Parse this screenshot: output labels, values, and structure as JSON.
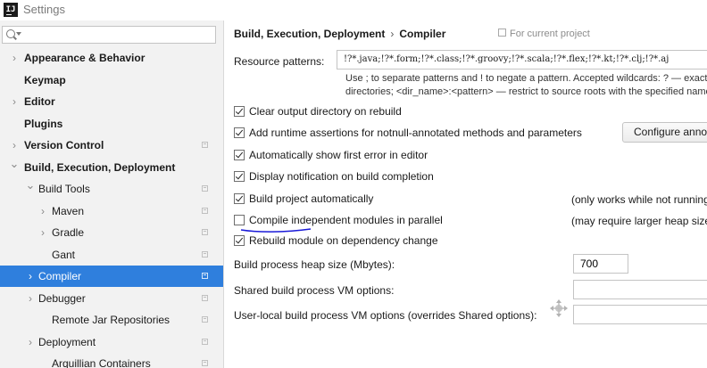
{
  "window": {
    "title": "Settings",
    "app_icon": "intellij-idea-icon"
  },
  "sidebar": {
    "search": {
      "value": "",
      "placeholder": ""
    },
    "items": [
      {
        "label": "Appearance & Behavior",
        "expanded": false,
        "bold": true,
        "indent": 0
      },
      {
        "label": "Keymap",
        "bold": true,
        "indent": 0
      },
      {
        "label": "Editor",
        "expanded": false,
        "bold": true,
        "indent": 0
      },
      {
        "label": "Plugins",
        "bold": true,
        "indent": 0
      },
      {
        "label": "Version Control",
        "expanded": false,
        "bold": true,
        "indent": 0
      },
      {
        "label": "Build, Execution, Deployment",
        "expanded": true,
        "bold": true,
        "indent": 0
      },
      {
        "label": "Build Tools",
        "expanded": true,
        "indent": 1
      },
      {
        "label": "Maven",
        "expanded": false,
        "indent": 2
      },
      {
        "label": "Gradle",
        "expanded": false,
        "indent": 2
      },
      {
        "label": "Gant",
        "indent": 3
      },
      {
        "label": "Compiler",
        "expanded": false,
        "indent": 1,
        "selected": true
      },
      {
        "label": "Debugger",
        "expanded": false,
        "indent": 1
      },
      {
        "label": "Remote Jar Repositories",
        "indent": 2
      },
      {
        "label": "Deployment",
        "expanded": false,
        "indent": 1
      },
      {
        "label": "Arquillian Containers",
        "indent": 2
      }
    ]
  },
  "main": {
    "breadcrumb": {
      "parent": "Build, Execution, Deployment",
      "separator": "›",
      "current": "Compiler"
    },
    "scope_note": "For current project",
    "resource_patterns": {
      "label": "Resource patterns:",
      "value": "!?*.java;!?*.form;!?*.class;!?*.groovy;!?*.scala;!?*.flex;!?*.kt;!?*.clj;!?*.aj"
    },
    "hint_line1": "Use ; to separate patterns and ! to negate a pattern. Accepted wildcards: ? — exactly one symbol; * — zero or more symbols; / — path separator",
    "hint_line2": "directories; <dir_name>:<pattern> — restrict to source roots with the specified name",
    "options": {
      "clear_output": {
        "label": "Clear output directory on rebuild",
        "checked": true
      },
      "runtime_assertions": {
        "label": "Add runtime assertions for notnull-annotated methods and parameters",
        "checked": true
      },
      "show_first_error": {
        "label": "Automatically show first error in editor",
        "checked": true
      },
      "display_notification": {
        "label": "Display notification on build completion",
        "checked": true
      },
      "build_automatically": {
        "label": "Build project automatically",
        "checked": true,
        "note": "(only works while not running / debugging)"
      },
      "compile_parallel": {
        "label": "Compile independent modules in parallel",
        "checked": false,
        "note": "(may require larger heap size)"
      },
      "rebuild_on_change": {
        "label": "Rebuild module on dependency change",
        "checked": true
      }
    },
    "configure_button": "Configure annotations...",
    "heap_size": {
      "label": "Build process heap size (Mbytes):",
      "value": "700"
    },
    "shared_vm_options": {
      "label": "Shared build process VM options:",
      "value": ""
    },
    "user_vm_options": {
      "label": "User-local build process VM options (overrides Shared options):",
      "value": ""
    }
  },
  "colors": {
    "selection": "#2f7fdd",
    "sidebar_bg": "#f2f2f2",
    "annotation_underline": "#1a1ad8"
  }
}
